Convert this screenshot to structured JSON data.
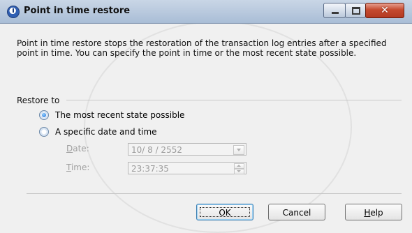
{
  "window": {
    "title": "Point in time restore",
    "icons": {
      "app": "clock-icon",
      "minimize": "minimize-icon",
      "maximize": "maximize-icon",
      "close": "close-icon"
    }
  },
  "description": "Point in time restore stops the restoration of the transaction log entries after a specified point in time. You can specify the point in time or the most recent state possible.",
  "restore_to": {
    "label": "Restore to",
    "options": [
      {
        "label": "The most recent state possible",
        "checked": true
      },
      {
        "label": "A specific date and time",
        "checked": false
      }
    ],
    "date": {
      "label_prefix": "D",
      "label_rest": "ate:",
      "value": "10/ 8 / 2552"
    },
    "time": {
      "label_prefix": "T",
      "label_rest": "ime:",
      "value": "23:37:35"
    }
  },
  "buttons": {
    "ok": "OK",
    "cancel": "Cancel",
    "help_prefix": "H",
    "help_rest": "elp"
  }
}
